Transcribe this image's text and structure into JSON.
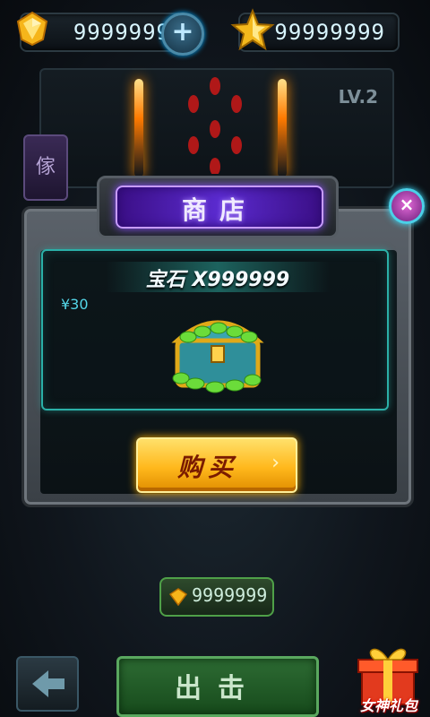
{
  "topbar": {
    "gems_value": "9999999",
    "stars_value": "99999999",
    "plus_label": "+"
  },
  "scene": {
    "level": "LV.2",
    "side_tab": "傢"
  },
  "dialog": {
    "title": "商店",
    "close_label": "×",
    "item": {
      "name": "宝石 X999999",
      "price": "¥30"
    },
    "buy_label": "购买",
    "buy_arrow": "›"
  },
  "bottom": {
    "gems_value": "9999999",
    "go_label": "出击",
    "gift_label": "女神礼包"
  },
  "colors": {
    "accent_gold": "#ffb81c",
    "accent_purple": "#5b2bd0",
    "accent_teal": "#2bb0a8"
  }
}
